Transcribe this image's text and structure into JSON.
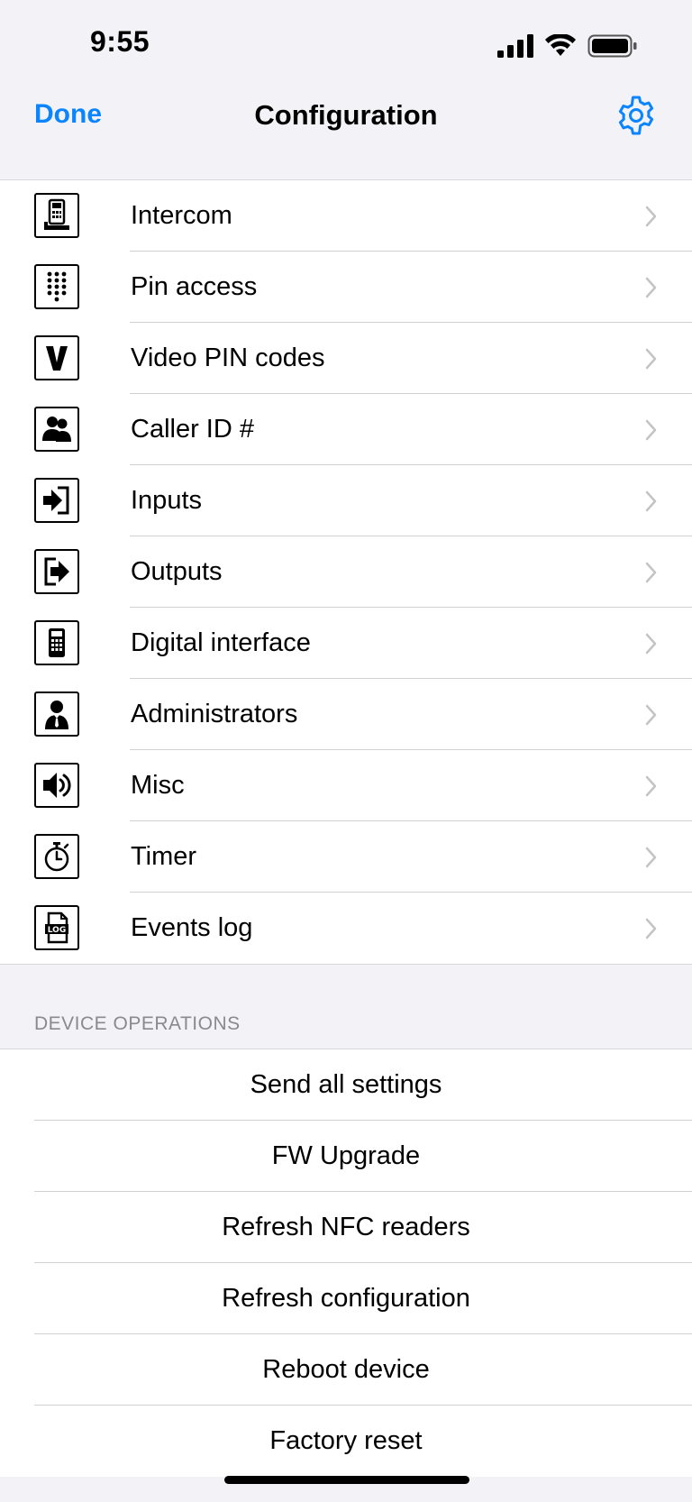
{
  "status": {
    "time": "9:55"
  },
  "nav": {
    "done_label": "Done",
    "title": "Configuration",
    "settings_icon": "gear-icon"
  },
  "colors": {
    "accent": "#0a84ff",
    "background": "#f2f2f7",
    "section_header": "#8a8a8e"
  },
  "menu": {
    "items": [
      {
        "label": "Intercom",
        "icon": "intercom-icon"
      },
      {
        "label": "Pin access",
        "icon": "keypad-icon"
      },
      {
        "label": "Video PIN codes",
        "icon": "video-pin-icon"
      },
      {
        "label": "Caller ID #",
        "icon": "caller-id-icon"
      },
      {
        "label": "Inputs",
        "icon": "inputs-icon"
      },
      {
        "label": "Outputs",
        "icon": "outputs-icon"
      },
      {
        "label": "Digital interface",
        "icon": "digital-interface-icon"
      },
      {
        "label": "Administrators",
        "icon": "administrator-icon"
      },
      {
        "label": "Misc",
        "icon": "speaker-icon"
      },
      {
        "label": "Timer",
        "icon": "stopwatch-icon"
      },
      {
        "label": "Events log",
        "icon": "log-icon"
      }
    ]
  },
  "device_operations": {
    "header": "DEVICE OPERATIONS",
    "items": [
      {
        "label": "Send all settings"
      },
      {
        "label": "FW Upgrade"
      },
      {
        "label": "Refresh NFC readers"
      },
      {
        "label": "Refresh configuration"
      },
      {
        "label": "Reboot device"
      },
      {
        "label": "Factory reset"
      }
    ]
  }
}
